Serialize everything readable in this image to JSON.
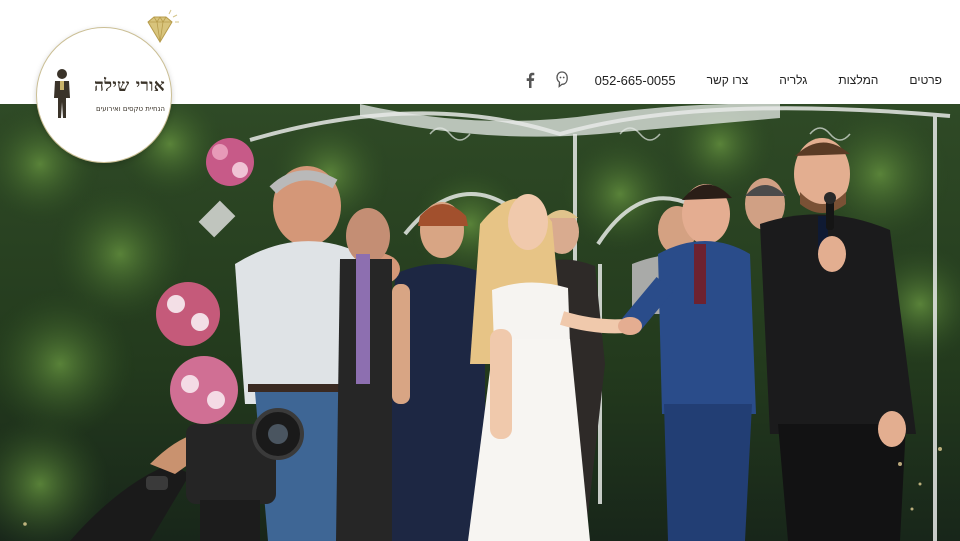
{
  "logo": {
    "title": "אורי שילה",
    "subtitle": "הנחיית טקסים ואירועים",
    "gem_icon": "diamond-icon",
    "figure_icon": "officiant-figure-icon",
    "brand_gold": "#c9b36a"
  },
  "nav": {
    "items": [
      {
        "label": "פרטים"
      },
      {
        "label": "המלצות"
      },
      {
        "label": "גלריה"
      },
      {
        "label": "צרו קשר"
      }
    ],
    "phone": "052-665-0055",
    "waze_icon": "waze-icon",
    "facebook_icon": "facebook-icon"
  },
  "hero": {
    "image": "wedding-ceremony-photo"
  }
}
